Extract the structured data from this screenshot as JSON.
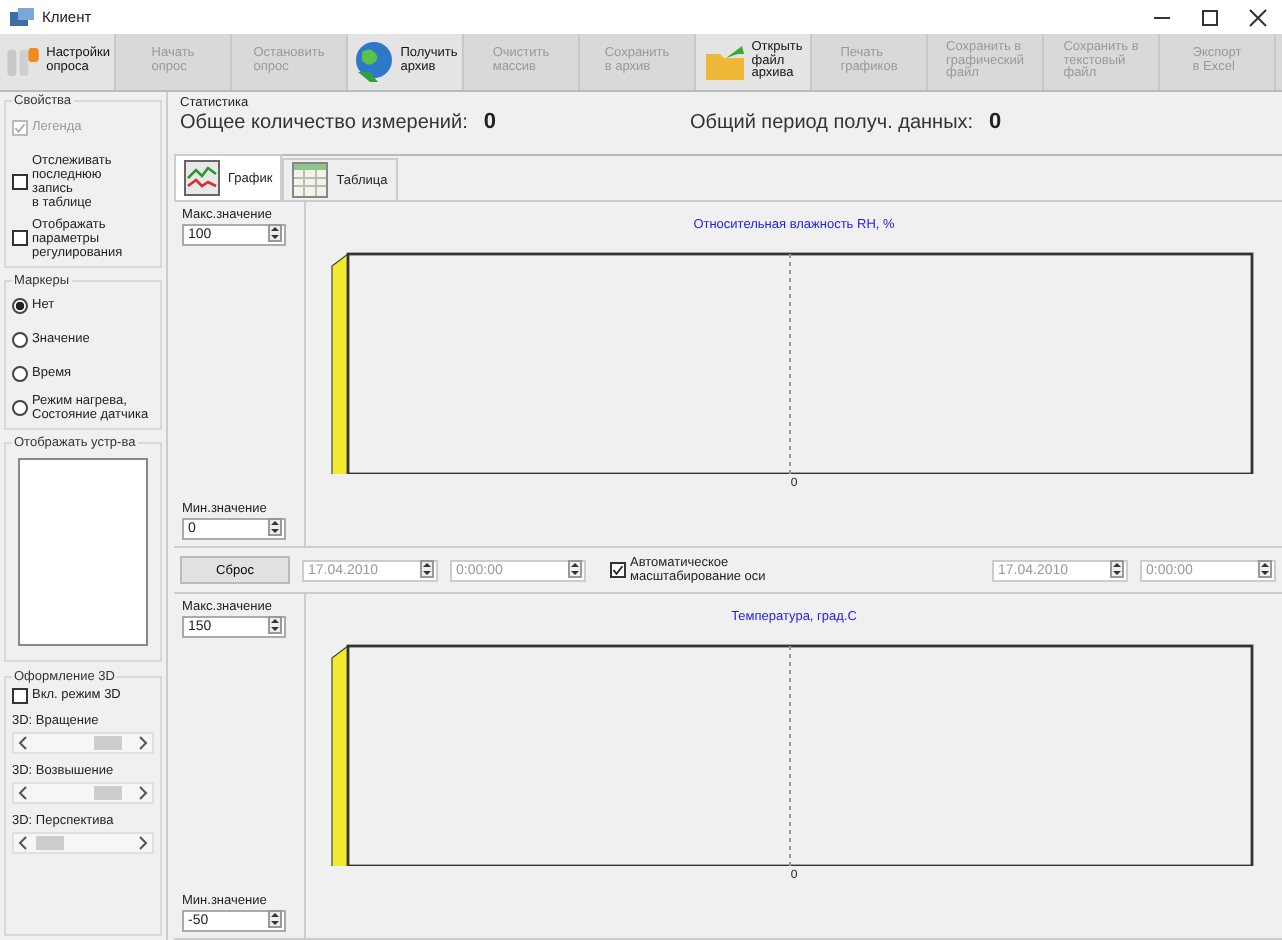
{
  "window": {
    "title": "Клиент"
  },
  "toolbar": [
    {
      "label": "Настройки\nопроса",
      "disabled": false
    },
    {
      "label": "Начать\nопрос",
      "disabled": true
    },
    {
      "label": "Остановить\nопрос",
      "disabled": true
    },
    {
      "label": "Получить\nархив",
      "disabled": false
    },
    {
      "label": "Очистить\nмассив",
      "disabled": true
    },
    {
      "label": "Сохранить\nв архив",
      "disabled": true
    },
    {
      "label": "Открыть\nфайл\nархива",
      "disabled": false
    },
    {
      "label": "Печать\nграфиков",
      "disabled": true
    },
    {
      "label": "Сохранить в\nграфический\nфайл",
      "disabled": true
    },
    {
      "label": "Сохранить в\nтекстовый\nфайл",
      "disabled": true
    },
    {
      "label": "Экспорт\nв Excel",
      "disabled": true
    }
  ],
  "properties": {
    "title": "Свойства",
    "options": [
      {
        "label": "Легенда",
        "checked": true,
        "disabled": true
      },
      {
        "label": "Отслеживать\nпоследнюю\nзапись\nв таблице",
        "checked": false,
        "disabled": false
      },
      {
        "label": "Отображать\nпараметры\nрегулирования",
        "checked": false,
        "disabled": false
      }
    ]
  },
  "markers": {
    "title": "Маркеры",
    "options": [
      {
        "label": "Нет",
        "selected": true
      },
      {
        "label": "Значение",
        "selected": false
      },
      {
        "label": "Время",
        "selected": false
      },
      {
        "label": "Режим нагрева,\nСостояние датчика",
        "selected": false
      }
    ]
  },
  "devices": {
    "title": "Отображать устр-ва"
  },
  "view3d": {
    "title": "Оформление 3D",
    "enable": {
      "label": "Вкл. режим 3D",
      "checked": false
    },
    "sliders": [
      {
        "label": "3D: Вращение"
      },
      {
        "label": "3D: Возвышение"
      },
      {
        "label": "3D: Перспектива"
      }
    ]
  },
  "statistics": {
    "title": "Статистика",
    "items": [
      {
        "label": "Общее количество измерений:",
        "value": "0"
      },
      {
        "label": "Общий период получ. данных:",
        "value": "0"
      }
    ]
  },
  "tabs": [
    {
      "label": "График",
      "selected": true
    },
    {
      "label": "Таблица",
      "selected": false
    }
  ],
  "charts": [
    {
      "title": "Относительная влажность RH, %",
      "max_label": "Макс.значение",
      "max": "100",
      "min_label": "Мин.значение",
      "min": "0",
      "x_label": "0"
    },
    {
      "title": "Температура, град.С",
      "max_label": "Макс.значение",
      "max": "150",
      "min_label": "Мин.значение",
      "min": "-50",
      "x_label": "0"
    }
  ],
  "range": {
    "reset": "Сброс",
    "start_date": {
      "value": "17.04.2010",
      "disabled": true
    },
    "start_time": {
      "value": "0:00:00",
      "disabled": true
    },
    "auto_scale": {
      "label": "Автоматическое\nмасштабирование оси",
      "checked": true
    },
    "end_date": {
      "value": "17.04.2010",
      "disabled": true
    },
    "end_time": {
      "value": "0:00:00",
      "disabled": true
    }
  }
}
